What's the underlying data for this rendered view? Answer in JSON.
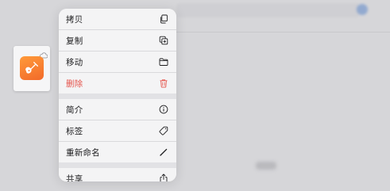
{
  "menu": {
    "group1": [
      {
        "label": "拷贝",
        "icon": "copy-icon"
      },
      {
        "label": "复制",
        "icon": "duplicate-icon"
      },
      {
        "label": "移动",
        "icon": "folder-icon"
      },
      {
        "label": "删除",
        "icon": "trash-icon",
        "destructive": true
      }
    ],
    "group2": [
      {
        "label": "简介",
        "icon": "info-icon"
      },
      {
        "label": "标签",
        "icon": "tag-icon"
      },
      {
        "label": "重新命名",
        "icon": "pencil-icon"
      }
    ],
    "group3": [
      {
        "label": "共享",
        "icon": "share-icon"
      }
    ]
  },
  "thumbnail": {
    "app_icon": "garageband-guitar-icon",
    "badge_icon": "cloud-icon"
  },
  "colors": {
    "destructive": "#e5534b",
    "app_orange": "#f26a2a",
    "menu_bg": "#f4f4f5"
  }
}
